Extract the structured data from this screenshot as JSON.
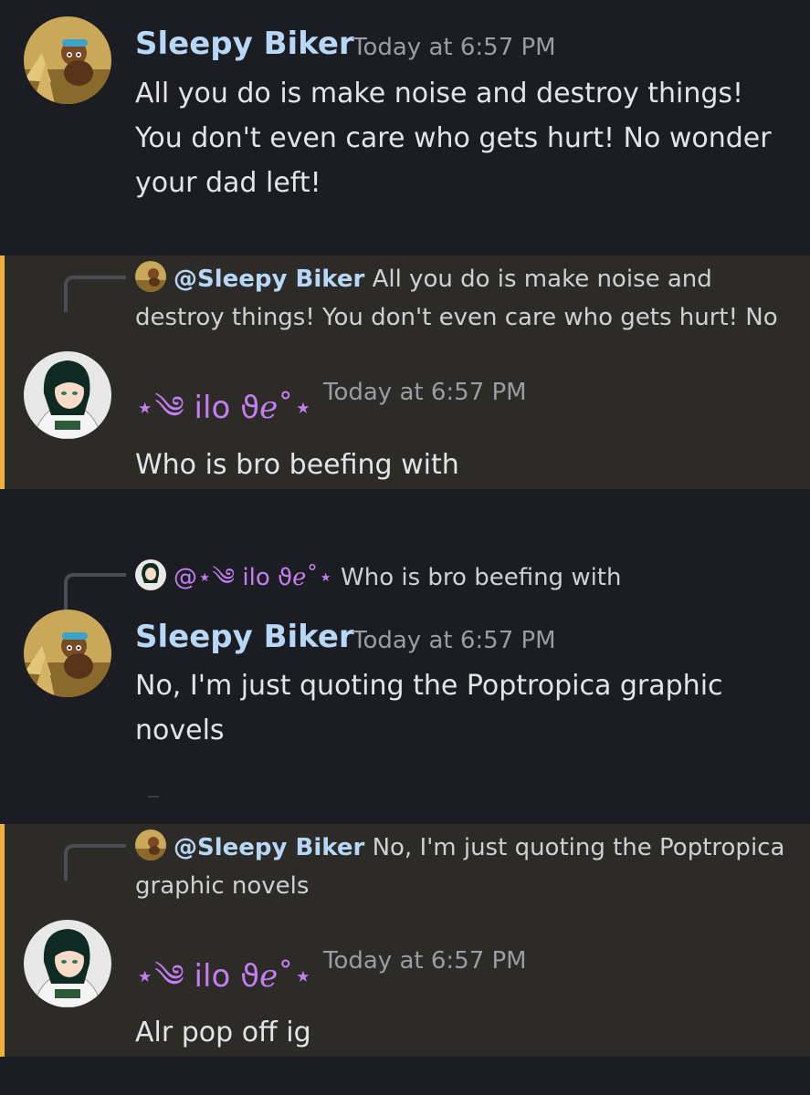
{
  "users": {
    "biker": {
      "name": "Sleepy Biker",
      "mention": "@Sleepy Biker",
      "name_color": "#b6d7f5",
      "avatar_icon": "cartoon-biker-avatar"
    },
    "ilo": {
      "name": "⋆༄ ilo ϑℯ˚⋆",
      "mention": "@⋆༄ ilo ϑℯ˚⋆",
      "name_color": "#c37ef0",
      "avatar_icon": "anime-girl-avatar"
    }
  },
  "colors": {
    "background": "#1c1d22",
    "mention_highlight": "#2c2b27",
    "mention_bar": "#f0b232"
  },
  "messages": [
    {
      "author": "Sleepy Biker",
      "timestamp": "Today at 6:57 PM",
      "text": "All you do is make noise and destroy things! You don't even care who gets hurt! No wonder your dad left!"
    },
    {
      "author": "⋆༄ ilo ϑℯ˚⋆",
      "timestamp": "Today at 6:57 PM",
      "reply_to": {
        "mention": "@Sleepy Biker",
        "text": "All you do is make noise and destroy things! You don't even care who gets hurt! No"
      },
      "text": "Who is bro beefing with"
    },
    {
      "author": "Sleepy Biker",
      "timestamp": "Today at 6:57 PM",
      "reply_to": {
        "mention": "@⋆༄ ilo ϑℯ˚⋆",
        "text": "Who is bro beefing with"
      },
      "text": "No, I'm just quoting the Poptropica graphic novels"
    },
    {
      "author": "⋆༄ ilo ϑℯ˚⋆",
      "timestamp": "Today at 6:57 PM",
      "reply_to": {
        "mention": "@Sleepy Biker",
        "text": "No, I'm just quoting the Poptropica graphic novels"
      },
      "text": "Alr pop off ig"
    }
  ]
}
